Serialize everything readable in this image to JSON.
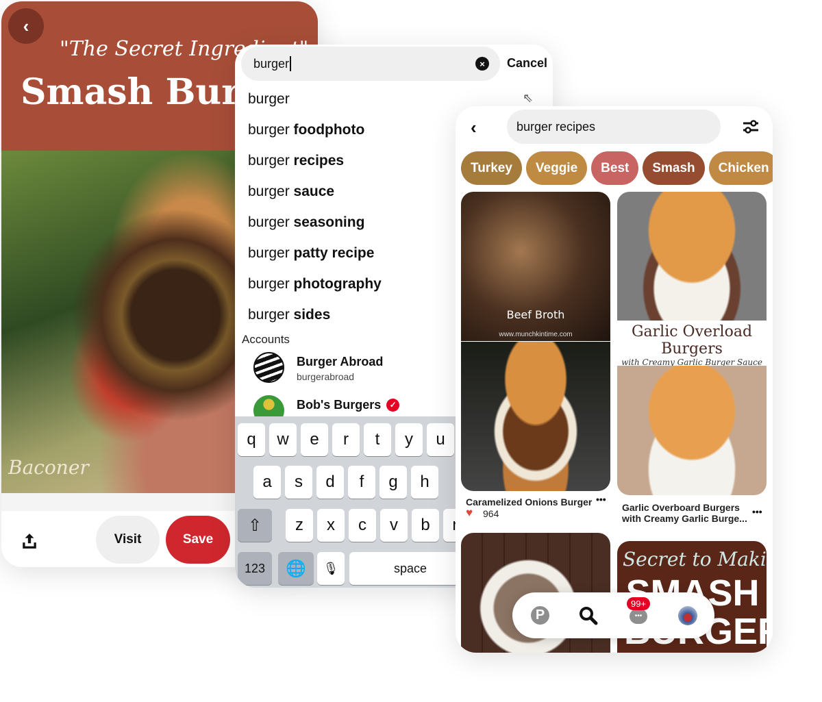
{
  "pin_screen": {
    "image_title_script": "\"The Secret Ingredient\"",
    "image_title": "Smash Burger",
    "watermark": "The Baconer",
    "visit_label": "Visit",
    "save_label": "Save",
    "save_color": "#d0272e",
    "header_color": "#a84e38",
    "icons": [
      "chevron-left-icon",
      "share-icon"
    ]
  },
  "search_screen": {
    "query": "burger",
    "cancel_label": "Cancel",
    "suggestions": [
      {
        "base": "burger",
        "bold": ""
      },
      {
        "base": "burger ",
        "bold": "foodphoto"
      },
      {
        "base": "burger ",
        "bold": "recipes"
      },
      {
        "base": "burger ",
        "bold": "sauce"
      },
      {
        "base": "burger ",
        "bold": "seasoning"
      },
      {
        "base": "burger ",
        "bold": "patty recipe"
      },
      {
        "base": "burger ",
        "bold": "photography"
      },
      {
        "base": "burger ",
        "bold": "sides"
      }
    ],
    "accounts_heading": "Accounts",
    "accounts": [
      {
        "name": "Burger Abroad",
        "handle": "burgerabroad",
        "verified": false
      },
      {
        "name": "Bob's Burgers",
        "verified": true
      }
    ],
    "keyboard": {
      "row1": [
        "q",
        "w",
        "e",
        "r",
        "t",
        "y",
        "u"
      ],
      "row2": [
        "a",
        "s",
        "d",
        "f",
        "g",
        "h"
      ],
      "row3": [
        "z",
        "x",
        "c",
        "v",
        "b",
        "n"
      ],
      "numbers_label": "123",
      "space_label": "space"
    }
  },
  "results_screen": {
    "query": "burger recipes",
    "chips": [
      {
        "label": "Turkey",
        "color": "#a57c3c"
      },
      {
        "label": "Veggie",
        "color": "#bf8a42"
      },
      {
        "label": "Best",
        "color": "#c86461"
      },
      {
        "label": "Smash",
        "color": "#954c30"
      },
      {
        "label": "Chicken",
        "color": "#c08a45"
      },
      {
        "label": "",
        "color": "#98a040"
      }
    ],
    "pins": [
      {
        "overlay": "Beef Broth",
        "overlay_url": "www.munchkintime.com",
        "title": "Caramelized Onions Burger",
        "reactions": "964"
      },
      {
        "overlay_title": "Garlic Overload Burgers",
        "overlay_sub": "with Creamy Garlic Burger Sauce",
        "title": "Garlic Overboard Burgers with Creamy Garlic Burge..."
      },
      {
        "overlay_script": "Secret to Making",
        "overlay_big": "SMASH BURGERS"
      }
    ],
    "nav": {
      "items": [
        "home-icon",
        "search-icon",
        "messages-icon",
        "profile-avatar"
      ],
      "badge": "99+",
      "active": "search-icon"
    }
  }
}
